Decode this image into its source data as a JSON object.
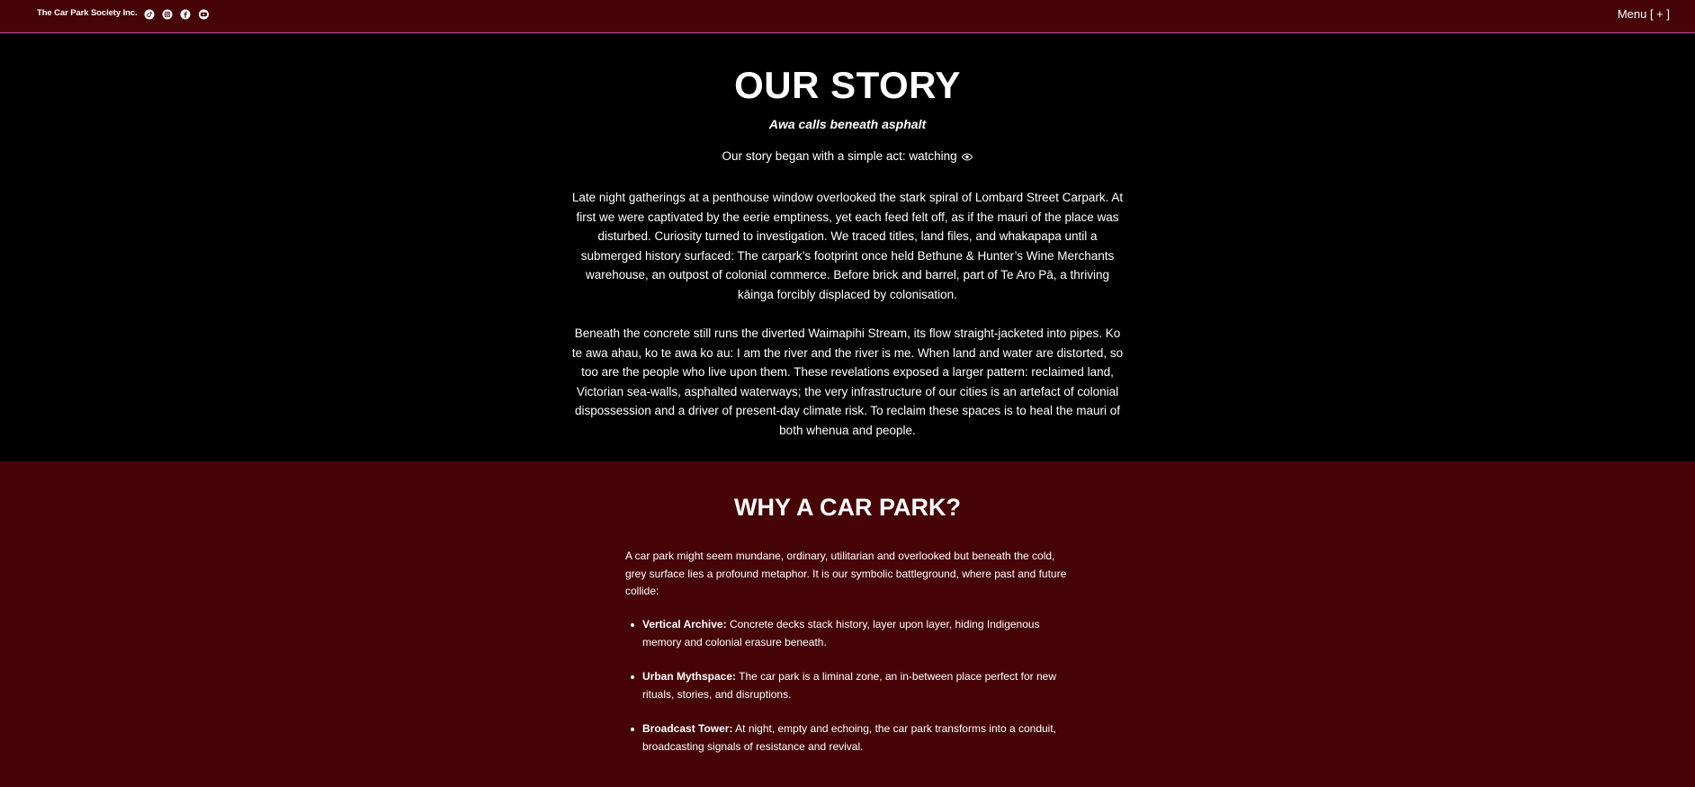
{
  "header": {
    "brand": "The Car Park Society Inc.",
    "socials": [
      {
        "icon": "tiktok-icon"
      },
      {
        "icon": "instagram-icon"
      },
      {
        "icon": "facebook-icon"
      },
      {
        "icon": "youtube-icon"
      }
    ],
    "menu_label": "Menu [ + ]"
  },
  "story": {
    "title": "OUR STORY",
    "tagline": "Awa calls beneath asphalt",
    "intro": "Our story began with a simple act: watching",
    "intro_icon": "eye-icon",
    "paragraph1": "Late night gatherings at a penthouse window overlooked the stark spiral of Lombard Street Carpark. At first we were captivated by the eerie emptiness, yet each feed felt off, as if the mauri of the place was disturbed. Curiosity turned to investigation. We traced titles, land files, and whakapapa until a submerged history surfaced: The carpark’s footprint once held Bethune & Hunter’s Wine Merchants warehouse, an outpost of colonial commerce.  Before brick and barrel, part of Te Aro Pā, a thriving kāinga forcibly displaced by colonisation.",
    "paragraph2": "Beneath the concrete still runs the diverted Waimapihi Stream, its flow straight-jacketed into pipes. Ko te awa ahau, ko te awa ko au: I am the river and the river is me. When land and water are distorted, so too are the people who live upon them. These revelations exposed a larger pattern: reclaimed land, Victorian sea-walls, asphalted waterways; the very infrastructure of our cities is an artefact of colonial dispossession and a driver of present-day climate risk. To reclaim these spaces is to heal the mauri of both whenua and people."
  },
  "why": {
    "title": "WHY A CAR PARK?",
    "intro": "A car park might seem mundane, ordinary, utilitarian and overlooked but beneath the cold, grey surface lies a profound metaphor. It is our symbolic battleground, where past and future collide:",
    "items": [
      {
        "term": "Vertical Archive:",
        "text": " Concrete decks stack history, layer upon layer, hiding Indigenous memory and colonial erasure beneath."
      },
      {
        "term": "Urban Mythspace:",
        "text": " The car park is a liminal zone, an in-between place perfect for new rituals, stories, and disruptions."
      },
      {
        "term": "Broadcast Tower:",
        "text": " At night, empty and echoing, the car park transforms into a conduit, broadcasting signals of resistance and revival."
      }
    ]
  },
  "colors": {
    "header_bg": "#470407",
    "header_border": "#c04bb0",
    "story_bg": "#000000",
    "why_bg": "#470407",
    "text": "#ffffff"
  }
}
